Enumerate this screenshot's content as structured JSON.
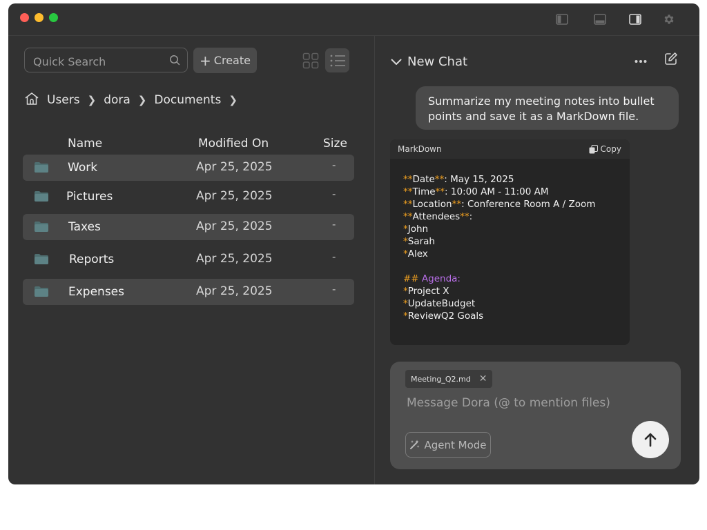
{
  "titlebar": {
    "icons": [
      "sidebar-left-icon",
      "panel-bottom-icon",
      "sidebar-right-icon",
      "gear-icon"
    ]
  },
  "files": {
    "search_placeholder": "Quick Search",
    "create_label": "Create",
    "breadcrumb": [
      "Users",
      "dora",
      "Documents"
    ],
    "columns": {
      "name": "Name",
      "modified": "Modified On",
      "size": "Size"
    },
    "rows": [
      {
        "name": "Work",
        "modified": "Apr 25, 2025",
        "size": "-"
      },
      {
        "name": "Pictures",
        "modified": "Apr 25, 2025",
        "size": "-"
      },
      {
        "name": "Taxes",
        "modified": "Apr 25, 2025",
        "size": "-"
      },
      {
        "name": "Reports",
        "modified": "Apr 25, 2025",
        "size": "-"
      },
      {
        "name": "Expenses",
        "modified": "Apr 25, 2025",
        "size": "-"
      }
    ]
  },
  "chat": {
    "title": "New Chat",
    "user_message": "Summarize my meeting notes into bullet points and save it as a MarkDown file.",
    "code": {
      "language": "MarkDown",
      "copy_label": "Copy",
      "lines": [
        {
          "mark": "**",
          "key": "Date",
          "value": ": May 15, 2025"
        },
        {
          "mark": "**",
          "key": "Time",
          "value": ": 10:00 AM - 11:00 AM"
        },
        {
          "mark": "**",
          "key": "Location",
          "value": ": Conference Room A / Zoom"
        },
        {
          "mark": "**",
          "key": "Attendees",
          "value": ":"
        },
        {
          "bullet": "*",
          "text": "John"
        },
        {
          "bullet": "*",
          "text": "Sarah"
        },
        {
          "bullet": "*",
          "text": "Alex"
        },
        {
          "blank": true
        },
        {
          "heading_mark": "##",
          "heading": "Agenda:"
        },
        {
          "bullet": "*",
          "text": "Project X"
        },
        {
          "bullet": "*",
          "text": "UpdateBudget"
        },
        {
          "bullet": "*",
          "text": "ReviewQ2 Goals"
        }
      ]
    },
    "composer": {
      "attachment": "Meeting_Q2.md",
      "placeholder": "Message Dora (@ to mention files)",
      "agent_mode_label": "Agent Mode"
    }
  },
  "colors": {
    "window_bg": "#323232",
    "row_highlight": "#474747",
    "markdown_marker": "#f0a020",
    "markdown_heading": "#b86ee8"
  }
}
